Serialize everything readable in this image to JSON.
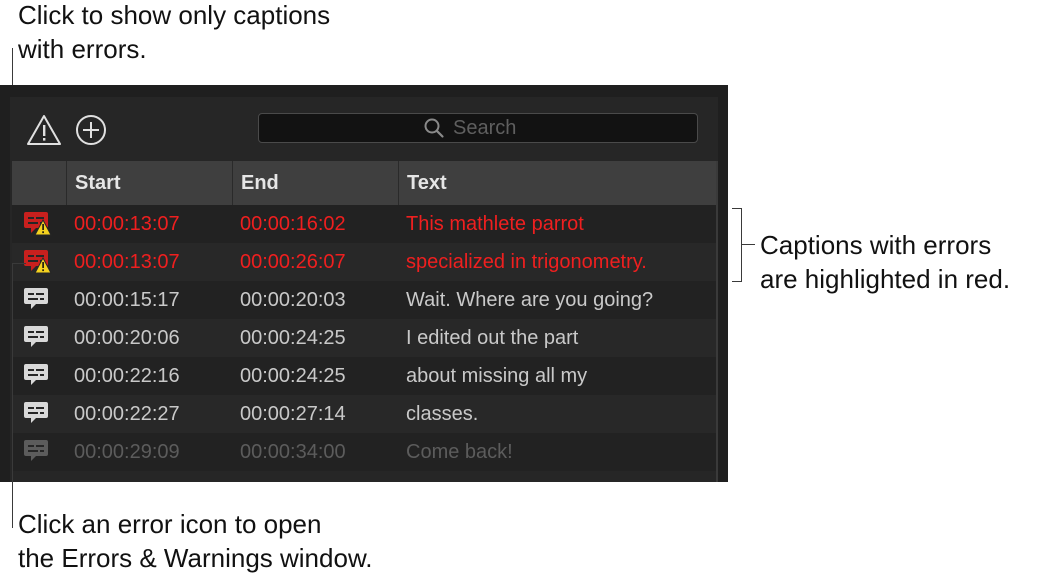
{
  "callouts": {
    "top": [
      "Click to show only captions",
      "with errors."
    ],
    "right": [
      "Captions with errors",
      "are highlighted in red."
    ],
    "bottom": [
      "Click an error icon to open",
      "the Errors & Warnings window."
    ]
  },
  "toolbar": {
    "errors_filter_icon": "warning-triangle-icon",
    "add_icon": "plus-circle-icon",
    "search_placeholder": "Search"
  },
  "table": {
    "columns": [
      "Start",
      "End",
      "Text"
    ],
    "rows": [
      {
        "start": "00:00:13:07",
        "end": "00:00:16:02",
        "text": "This mathlete parrot",
        "status": "error"
      },
      {
        "start": "00:00:13:07",
        "end": "00:00:26:07",
        "text": "specialized in trigonometry.",
        "status": "error"
      },
      {
        "start": "00:00:15:17",
        "end": "00:00:20:03",
        "text": "Wait. Where are you going?",
        "status": "normal"
      },
      {
        "start": "00:00:20:06",
        "end": "00:00:24:25",
        "text": "I edited out the part",
        "status": "normal"
      },
      {
        "start": "00:00:22:16",
        "end": "00:00:24:25",
        "text": "about missing all my",
        "status": "normal"
      },
      {
        "start": "00:00:22:27",
        "end": "00:00:27:14",
        "text": "classes.",
        "status": "normal"
      },
      {
        "start": "00:00:29:09",
        "end": "00:00:34:00",
        "text": "Come back!",
        "status": "dim"
      }
    ]
  },
  "colors": {
    "error_text": "#ef1f1f",
    "error_icon": "#c8201e",
    "warning_badge": "#f5d21f",
    "normal_icon": "#d9d9d9",
    "dim_icon": "#5c5c5c"
  }
}
